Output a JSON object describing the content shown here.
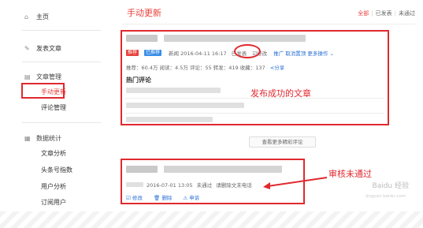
{
  "sidebar": {
    "home": "主页",
    "publish": "发表文章",
    "article_manage": "文章管理",
    "manual_update": "手动更新",
    "comment_manage": "评论管理",
    "data_stats": "数据统计",
    "article_analysis": "文章分析",
    "toutiao_index": "头条号指数",
    "user_analysis": "用户分析",
    "subscribers": "订阅用户"
  },
  "header": {
    "title": "手动更新",
    "filters": [
      "全部",
      "已发表",
      "未通过"
    ]
  },
  "article1": {
    "tags": [
      {
        "label": "推荐",
        "color": "#e8423c"
      },
      {
        "label": "已推荐",
        "color": "#3a8ee6"
      }
    ],
    "category": "新闻",
    "datetime": "2016-04-11 16:17",
    "status": "已发表",
    "edit_label": "修改",
    "promote_label": "推广",
    "unpin_label": "取消置顶",
    "more_label": "更多操作",
    "stats": "推荐：60.4万   阅读：4.5万   评论：55   转发：419   收藏：137",
    "share_label": "分享",
    "hot_comments": "热门评论",
    "annotation": "发布成功的文章"
  },
  "more_comments_button": "查看更多精彩评论",
  "article2": {
    "datetime": "2016-07-01 13:05",
    "status": "未通过",
    "reason": "请删除文末电话",
    "actions": [
      "修改",
      "删除",
      "申诉"
    ],
    "annotation": "审核未通过"
  },
  "watermark": {
    "brand": "Baidu 经验",
    "url": "jingyan.baidu.com"
  },
  "colors": {
    "accent": "#e8423c",
    "link": "#2a6fd6",
    "annotation_red": "#e0292f"
  }
}
